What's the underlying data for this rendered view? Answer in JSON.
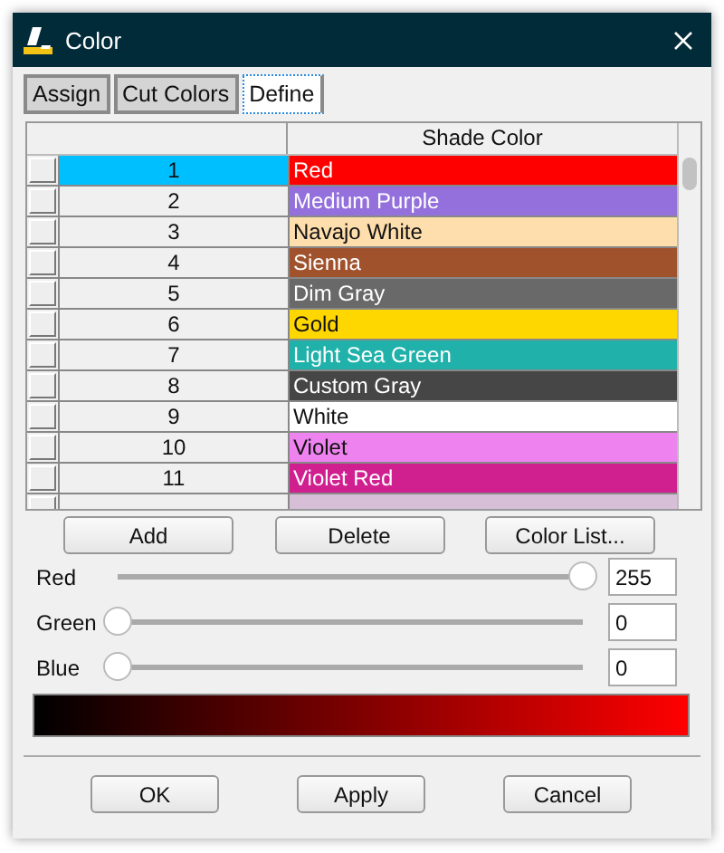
{
  "window": {
    "title": "Color"
  },
  "tabs": [
    {
      "label": "Assign",
      "selected": false
    },
    {
      "label": "Cut Colors",
      "selected": false
    },
    {
      "label": "Define",
      "selected": true
    }
  ],
  "table": {
    "columns": [
      "Shade Color"
    ],
    "rows": [
      {
        "number": "1",
        "name": "Red",
        "color": "#ff0000",
        "selected": true
      },
      {
        "number": "2",
        "name": "Medium Purple",
        "color": "#9370db",
        "selected": false
      },
      {
        "number": "3",
        "name": "Navajo White",
        "color": "#ffdead",
        "selected": false
      },
      {
        "number": "4",
        "name": "Sienna",
        "color": "#a0522d",
        "selected": false
      },
      {
        "number": "5",
        "name": "Dim Gray",
        "color": "#696969",
        "selected": false
      },
      {
        "number": "6",
        "name": "Gold",
        "color": "#ffd700",
        "selected": false
      },
      {
        "number": "7",
        "name": "Light Sea Green",
        "color": "#20b2aa",
        "selected": false
      },
      {
        "number": "8",
        "name": "Custom Gray",
        "color": "#464646",
        "selected": false
      },
      {
        "number": "9",
        "name": "White",
        "color": "#ffffff",
        "selected": false
      },
      {
        "number": "10",
        "name": "Violet",
        "color": "#ee82ee",
        "selected": false
      },
      {
        "number": "11",
        "name": "Violet Red",
        "color": "#d02090",
        "selected": false
      },
      {
        "color": "#d8bfd8",
        "selected": false
      }
    ]
  },
  "list_buttons": [
    "Add",
    "Delete",
    "Color List..."
  ],
  "channels": [
    {
      "name": "Red",
      "level": 1,
      "value": "255"
    },
    {
      "name": "Green",
      "level": 0,
      "value": "0"
    },
    {
      "name": "Blue",
      "level": 0,
      "value": "0"
    }
  ],
  "buttons": [
    "OK",
    "Apply",
    "Cancel"
  ]
}
